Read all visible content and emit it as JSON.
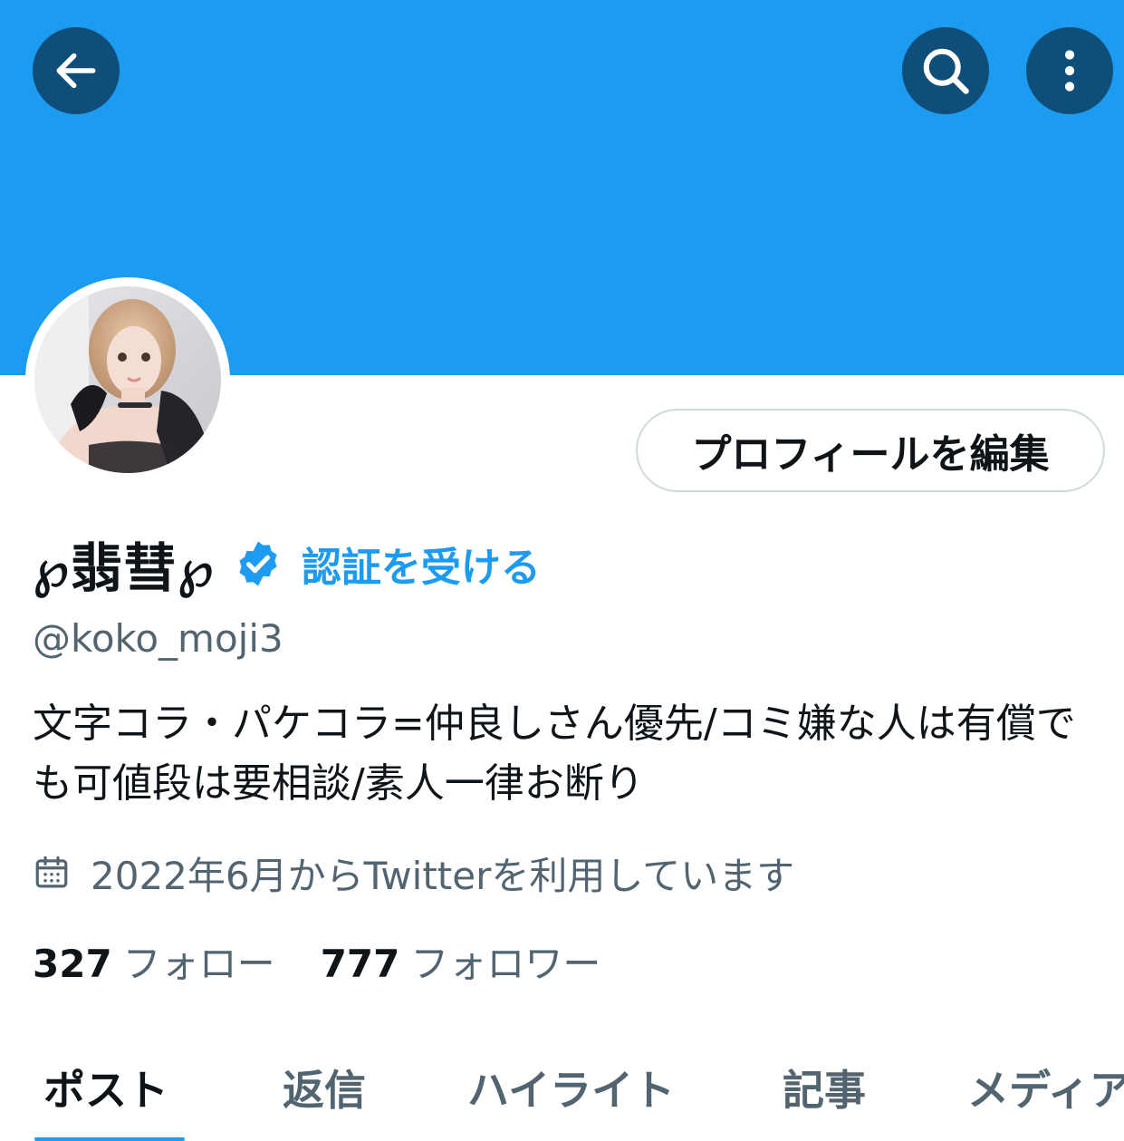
{
  "header": {
    "back_icon": "arrow-left-icon",
    "search_icon": "search-icon",
    "more_icon": "more-vertical-icon",
    "banner_color": "#1d9bf0",
    "button_color": "#104e7a"
  },
  "profile": {
    "edit_button_label": "プロフィールを編集",
    "display_name": "℘翡彗℘",
    "verified_icon": "verified-badge-icon",
    "get_verified_label": "認証を受ける",
    "handle": "@koko_moji3",
    "bio": "文字コラ・パケコラ=仲良しさん優先/コミ嫌な人は有償でも可値段は要相談/素人一律お断り",
    "joined_icon": "calendar-icon",
    "joined": "2022年6月からTwitterを利用しています",
    "following_count": "327",
    "following_label": "フォロー",
    "followers_count": "777",
    "followers_label": "フォロワー"
  },
  "tabs": [
    {
      "label": "ポスト",
      "active": true
    },
    {
      "label": "返信",
      "active": false
    },
    {
      "label": "ハイライト",
      "active": false
    },
    {
      "label": "記事",
      "active": false
    },
    {
      "label": "メディア",
      "active": false
    }
  ],
  "colors": {
    "accent": "#1d9bf0",
    "text_primary": "#0f1419",
    "text_secondary": "#536471",
    "border": "#cfd9de"
  }
}
